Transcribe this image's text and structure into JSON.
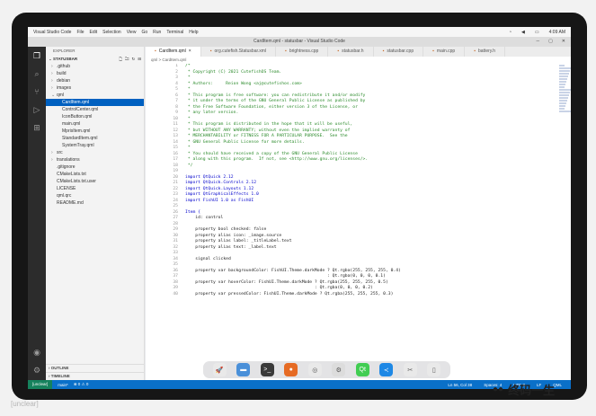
{
  "topbar": {
    "app_name": "Visual Studio Code",
    "menus": [
      "File",
      "Edit",
      "Selection",
      "View",
      "Go",
      "Run",
      "Terminal",
      "Help"
    ],
    "time": "4:09 AM"
  },
  "window": {
    "title": "CardItem.qml - statusbar - Visual Studio Code"
  },
  "sidebar": {
    "header": "EXPLORER",
    "section": "STATUSBAR",
    "tree": [
      {
        "label": ".github",
        "depth": 1,
        "kind": "folder"
      },
      {
        "label": "build",
        "depth": 1,
        "kind": "folder"
      },
      {
        "label": "debian",
        "depth": 1,
        "kind": "folder"
      },
      {
        "label": "images",
        "depth": 1,
        "kind": "folder"
      },
      {
        "label": "qml",
        "depth": 1,
        "kind": "folder-open"
      },
      {
        "label": "CardItem.qml",
        "depth": 2,
        "kind": "file",
        "selected": true
      },
      {
        "label": "ControlCenter.qml",
        "depth": 2,
        "kind": "file"
      },
      {
        "label": "IconButton.qml",
        "depth": 2,
        "kind": "file"
      },
      {
        "label": "main.qml",
        "depth": 2,
        "kind": "file"
      },
      {
        "label": "MprisItem.qml",
        "depth": 2,
        "kind": "file"
      },
      {
        "label": "StandardItem.qml",
        "depth": 2,
        "kind": "file"
      },
      {
        "label": "SystemTray.qml",
        "depth": 2,
        "kind": "file"
      },
      {
        "label": "src",
        "depth": 1,
        "kind": "folder"
      },
      {
        "label": "translations",
        "depth": 1,
        "kind": "folder"
      },
      {
        "label": ".gitignore",
        "depth": 1,
        "kind": "file"
      },
      {
        "label": "CMakeLists.txt",
        "depth": 1,
        "kind": "file"
      },
      {
        "label": "CMakeLists.txt.user",
        "depth": 1,
        "kind": "file"
      },
      {
        "label": "LICENSE",
        "depth": 1,
        "kind": "file"
      },
      {
        "label": "qml.qrc",
        "depth": 1,
        "kind": "file"
      },
      {
        "label": "README.md",
        "depth": 1,
        "kind": "file"
      }
    ],
    "outline": "OUTLINE",
    "timeline": "TIMELINE"
  },
  "tabs": [
    {
      "label": "CardItem.qml",
      "active": true
    },
    {
      "label": "org.cutefish.Statusbar.xml",
      "active": false
    },
    {
      "label": "brightness.cpp",
      "active": false
    },
    {
      "label": "statusbar.h",
      "active": false
    },
    {
      "label": "statusbar.cpp",
      "active": false
    },
    {
      "label": "main.cpp",
      "active": false
    },
    {
      "label": "battery.h",
      "active": false
    }
  ],
  "breadcrumb": "qml > CardItem.qml",
  "code_lines": [
    {
      "n": "1",
      "t": "/*",
      "c": "cm"
    },
    {
      "n": "2",
      "t": " * Copyright (C) 2021 CutefishOS Team.",
      "c": "cm"
    },
    {
      "n": "3",
      "t": " *",
      "c": "cm"
    },
    {
      "n": "4",
      "t": " * Authors:     Reion Wong <aj@cutefishos.com>",
      "c": "cm"
    },
    {
      "n": "5",
      "t": " *",
      "c": "cm"
    },
    {
      "n": "6",
      "t": " * This program is free software: you can redistribute it and/or modify",
      "c": "cm"
    },
    {
      "n": "7",
      "t": " * it under the terms of the GNU General Public License as published by",
      "c": "cm"
    },
    {
      "n": "8",
      "t": " * the Free Software Foundation, either version 3 of the License, or",
      "c": "cm"
    },
    {
      "n": "9",
      "t": " * any later version.",
      "c": "cm"
    },
    {
      "n": "10",
      "t": " *",
      "c": "cm"
    },
    {
      "n": "11",
      "t": " * This program is distributed in the hope that it will be useful,",
      "c": "cm"
    },
    {
      "n": "12",
      "t": " * but WITHOUT ANY WARRANTY; without even the implied warranty of",
      "c": "cm"
    },
    {
      "n": "13",
      "t": " * MERCHANTABILITY or FITNESS FOR A PARTICULAR PURPOSE.  See the",
      "c": "cm"
    },
    {
      "n": "14",
      "t": " * GNU General Public License for more details.",
      "c": "cm"
    },
    {
      "n": "15",
      "t": " *",
      "c": "cm"
    },
    {
      "n": "16",
      "t": " * You should have received a copy of the GNU General Public License",
      "c": "cm"
    },
    {
      "n": "17",
      "t": " * along with this program.  If not, see <http://www.gnu.org/licenses/>.",
      "c": "cm"
    },
    {
      "n": "18",
      "t": " */",
      "c": "cm"
    },
    {
      "n": "19",
      "t": "",
      "c": "pl"
    },
    {
      "n": "20",
      "t": "import QtQuick 2.12",
      "c": "kw"
    },
    {
      "n": "21",
      "t": "import QtQuick.Controls 2.12",
      "c": "kw"
    },
    {
      "n": "22",
      "t": "import QtQuick.Layouts 1.12",
      "c": "kw"
    },
    {
      "n": "23",
      "t": "import QtGraphicalEffects 1.0",
      "c": "kw"
    },
    {
      "n": "24",
      "t": "import FishUI 1.0 as FishUI",
      "c": "kw"
    },
    {
      "n": "25",
      "t": "",
      "c": "pl"
    },
    {
      "n": "26",
      "t": "Item {",
      "c": "kw"
    },
    {
      "n": "27",
      "t": "    id: control",
      "c": "pl"
    },
    {
      "n": "28",
      "t": "",
      "c": "pl"
    },
    {
      "n": "29",
      "t": "    property bool checked: false",
      "c": "pl"
    },
    {
      "n": "30",
      "t": "    property alias icon: _image.source",
      "c": "pl"
    },
    {
      "n": "31",
      "t": "    property alias label: _titleLabel.text",
      "c": "pl"
    },
    {
      "n": "32",
      "t": "    property alias text: _label.text",
      "c": "pl"
    },
    {
      "n": "33",
      "t": "",
      "c": "pl"
    },
    {
      "n": "34",
      "t": "    signal clicked",
      "c": "pl"
    },
    {
      "n": "35",
      "t": "",
      "c": "pl"
    },
    {
      "n": "36",
      "t": "    property var backgroundColor: FishUI.Theme.darkMode ? Qt.rgba(255, 255, 255, 0.4)",
      "c": "pl"
    },
    {
      "n": "37",
      "t": "                                                        : Qt.rgba(0, 0, 0, 0.1)",
      "c": "pl"
    },
    {
      "n": "38",
      "t": "    property var hoverColor: FishUI.Theme.darkMode ? Qt.rgba(255, 255, 255, 0.5)",
      "c": "pl"
    },
    {
      "n": "39",
      "t": "                                                   : Qt.rgba(0, 0, 0, 0.2)",
      "c": "pl"
    },
    {
      "n": "40",
      "t": "    property var pressedColor: FishUI.Theme.darkMode ? Qt.rgba(255, 255, 255, 0.3)",
      "c": "pl"
    }
  ],
  "statusbar": {
    "remote": "[unclear]",
    "branch": "main*",
    "problems": "⊗ 0 ⚠ 0",
    "position": "Ln 56, Col 38",
    "spaces": "Spaces: 4",
    "encoding": "UTF-8",
    "eol": "LF",
    "language": "QML"
  },
  "dock": {
    "apps": [
      {
        "name": "launcher",
        "color": "#e9e9e9",
        "glyph": "🚀"
      },
      {
        "name": "files",
        "color": "#4a90d9",
        "glyph": "▬"
      },
      {
        "name": "terminal",
        "color": "#3a3a3a",
        "glyph": ">_"
      },
      {
        "name": "firefox",
        "color": "#e66b24",
        "glyph": "●"
      },
      {
        "name": "chrome",
        "color": "#e9e9e9",
        "glyph": "◎"
      },
      {
        "name": "settings",
        "color": "#dcdcdc",
        "glyph": "⚙"
      },
      {
        "name": "qt-creator",
        "color": "#41cd52",
        "glyph": "Qt"
      },
      {
        "name": "vscode",
        "color": "#1e88e5",
        "glyph": "≺"
      },
      {
        "name": "screenshot",
        "color": "#e9e9e9",
        "glyph": "✂"
      },
      {
        "name": "trash",
        "color": "#e9e9e9",
        "glyph": "▯"
      }
    ]
  },
  "watermarks": {
    "left": "[unclear]",
    "right": "终码一生"
  }
}
